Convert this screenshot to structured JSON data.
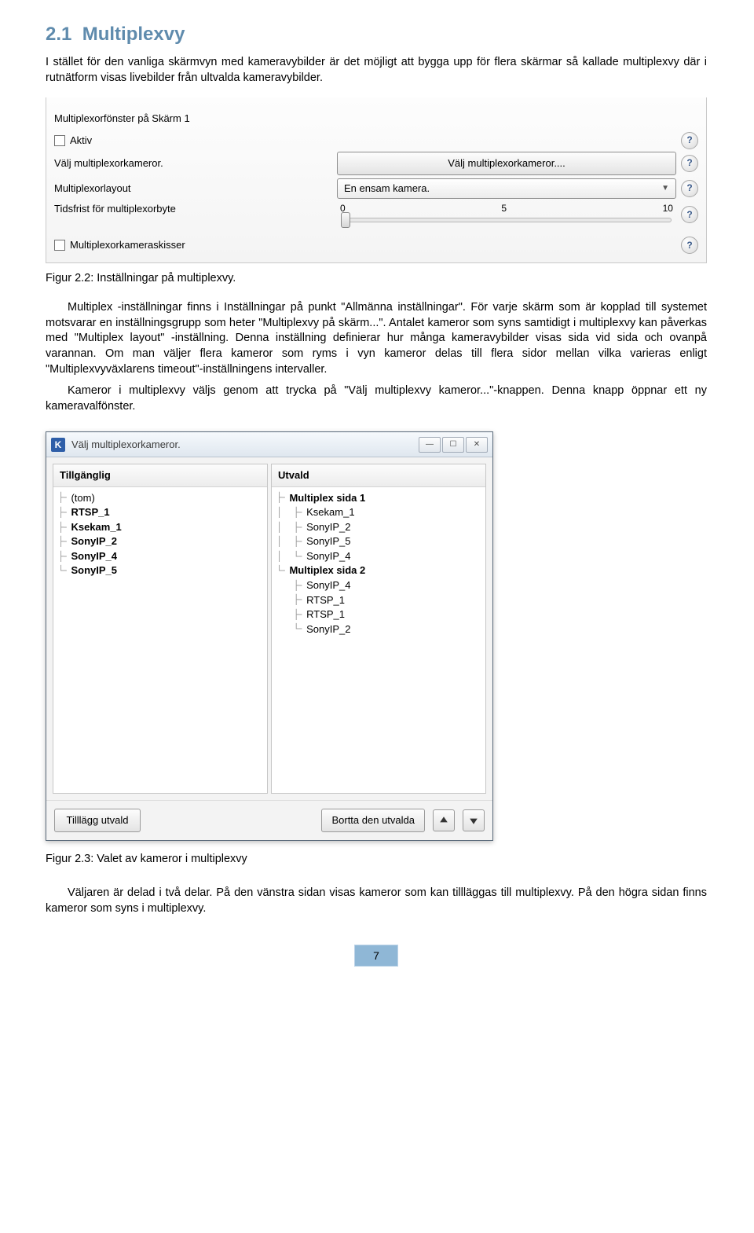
{
  "section": {
    "number": "2.1",
    "title": "Multiplexvy"
  },
  "para1": "I stället för den vanliga skärmvyn med kameravybilder är det möjligt att bygga upp för flera skärmar så kallade multiplexvy där i rutnätform visas livebilder från ultvalda kameravybilder.",
  "fig22": {
    "caption": "Figur 2.2: Inställningar på multiplexvy.",
    "group_title": "Multiplexorfönster på Skärm 1",
    "active_label": "Aktiv",
    "choose_label": "Välj multiplexorkameror.",
    "choose_button": "Välj multiplexorkameror....",
    "layout_label": "Multiplexorlayout",
    "layout_value": "En ensam kamera.",
    "timeout_label": "Tidsfrist för multiplexorbyte",
    "tick0": "0",
    "tick5": "5",
    "tick10": "10",
    "sketches_label": "Multiplexorkameraskisser"
  },
  "para2a": "Multiplex -inställningar finns i Inställningar på punkt \"Allmänna inställningar\". För varje skärm som är kopplad till systemet motsvarar en inställningsgrupp som heter \"Multiplexvy på skärm...\". Antalet kameror som syns samtidigt i multiplexvy kan påverkas med \"Multiplex layout\" -inställning. Denna inställning definierar hur många kameravybilder visas sida vid sida och ovanpå varannan. Om man väljer flera kameror som ryms i vyn kameror delas till flera sidor mellan vilka varieras enligt \"Multiplexvyväxlarens timeout\"-inställningens intervaller.",
  "para2b": "Kameror i multiplexvy väljs genom att trycka på \"Välj multiplexvy kameror...\"-knappen. Denna knapp öppnar ett ny kameravalfönster.",
  "fig23": {
    "title": "Välj multiplexorkameror.",
    "col_left": "Tillgänglig",
    "col_right": "Utvald",
    "left_items": [
      "(tom)",
      "RTSP_1",
      "Ksekam_1",
      "SonyIP_2",
      "SonyIP_4",
      "SonyIP_5"
    ],
    "left_bold": [
      false,
      true,
      true,
      true,
      true,
      true
    ],
    "right_groups": [
      {
        "name": "Multiplex sida 1",
        "items": [
          "Ksekam_1",
          "SonyIP_2",
          "SonyIP_5",
          "SonyIP_4"
        ]
      },
      {
        "name": "Multiplex sida 2",
        "items": [
          "SonyIP_4",
          "RTSP_1",
          "RTSP_1",
          "SonyIP_2"
        ]
      }
    ],
    "btn_add": "Tilllägg utvald",
    "btn_remove": "Bortta den utvalda",
    "caption": "Figur 2.3: Valet av kameror i multiplexvy"
  },
  "para3": "Väljaren är delad i två delar. På den vänstra sidan visas kameror som kan tillläggas till multiplexvy. På den högra sidan finns kameror som syns i multiplexvy.",
  "page_number": "7"
}
